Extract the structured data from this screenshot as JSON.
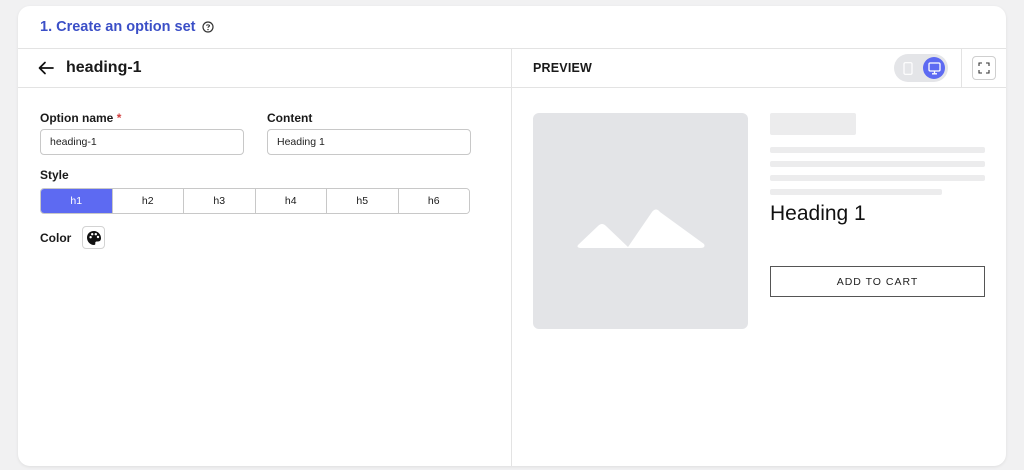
{
  "card": {
    "title": "1. Create an option set",
    "help_icon": "question-circle-icon"
  },
  "editor": {
    "back_icon": "arrow-left-icon",
    "heading": "heading-1",
    "option_name": {
      "label": "Option name",
      "required_mark": "*",
      "value": "heading-1"
    },
    "content": {
      "label": "Content",
      "value": "Heading 1"
    },
    "style": {
      "label": "Style",
      "options": [
        "h1",
        "h2",
        "h3",
        "h4",
        "h5",
        "h6"
      ],
      "selected": "h1"
    },
    "color": {
      "label": "Color",
      "icon": "palette-icon"
    }
  },
  "preview": {
    "label": "PREVIEW",
    "device_toggle": {
      "options": [
        "mobile-icon",
        "desktop-icon"
      ],
      "selected": "desktop"
    },
    "fullscreen_icon": "expand-icon",
    "image_icon": "image-placeholder-icon",
    "heading_text": "Heading 1",
    "add_to_cart_label": "ADD TO CART"
  },
  "colors": {
    "accent": "#5d6af2",
    "title": "#3b4fc7",
    "required": "#d23d3d"
  }
}
